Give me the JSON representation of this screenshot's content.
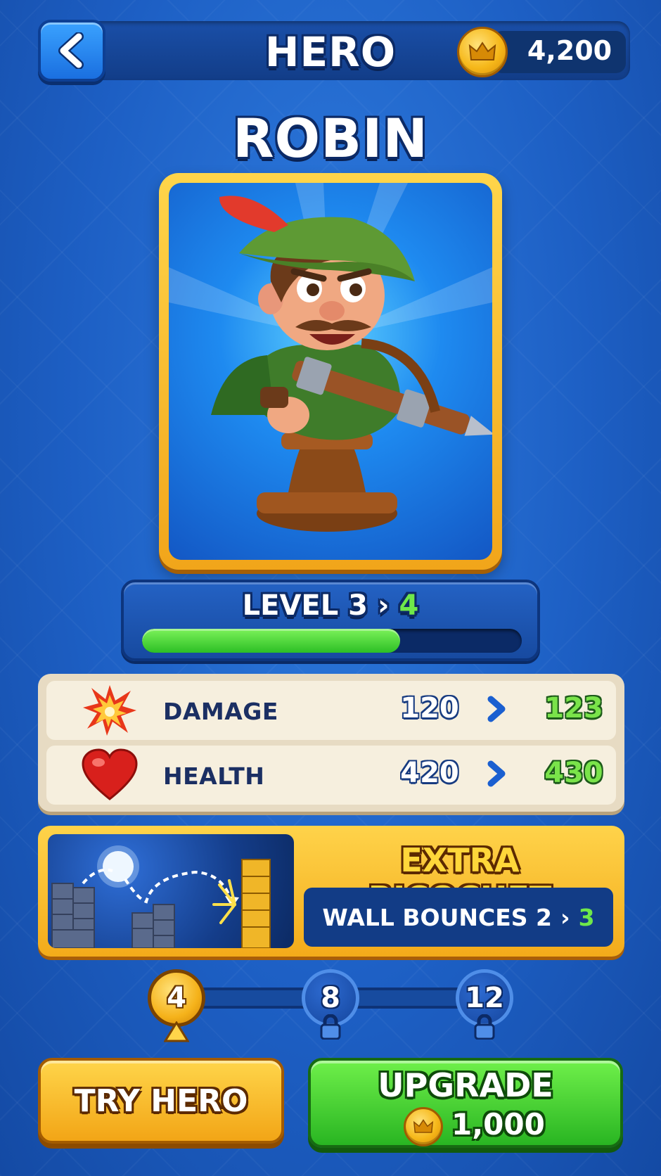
{
  "header": {
    "back_icon": "chevron-left-icon",
    "title": "HERO",
    "coins": "4,200",
    "coin_icon": "crown-coin-icon"
  },
  "hero": {
    "name": "ROBIN",
    "portrait": "robin-hood-crossbow-figure"
  },
  "level": {
    "label": "LEVEL 3",
    "arrow": "›",
    "next": "4",
    "progress": 0.68
  },
  "stats": [
    {
      "icon": "explosion-icon",
      "label": "DAMAGE",
      "current": "120",
      "next": "123"
    },
    {
      "icon": "heart-icon",
      "label": "HEALTH",
      "current": "420",
      "next": "430"
    }
  ],
  "ability": {
    "title": "EXTRA RICOCHET",
    "desc_label": "WALL BOUNCES 2",
    "arrow": "›",
    "desc_next": "3",
    "image": "ricochet-wall-bounce-illustration"
  },
  "milestones": [
    {
      "value": "4",
      "state": "active"
    },
    {
      "value": "8",
      "state": "locked"
    },
    {
      "value": "12",
      "state": "locked"
    }
  ],
  "buttons": {
    "try_label": "TRY HERO",
    "upgrade_label": "UPGRADE",
    "upgrade_cost": "1,000"
  },
  "colors": {
    "background": "#1d5fc4",
    "gold": "#f5b21a",
    "green": "#2cbf25",
    "navy": "#0c2a66"
  }
}
